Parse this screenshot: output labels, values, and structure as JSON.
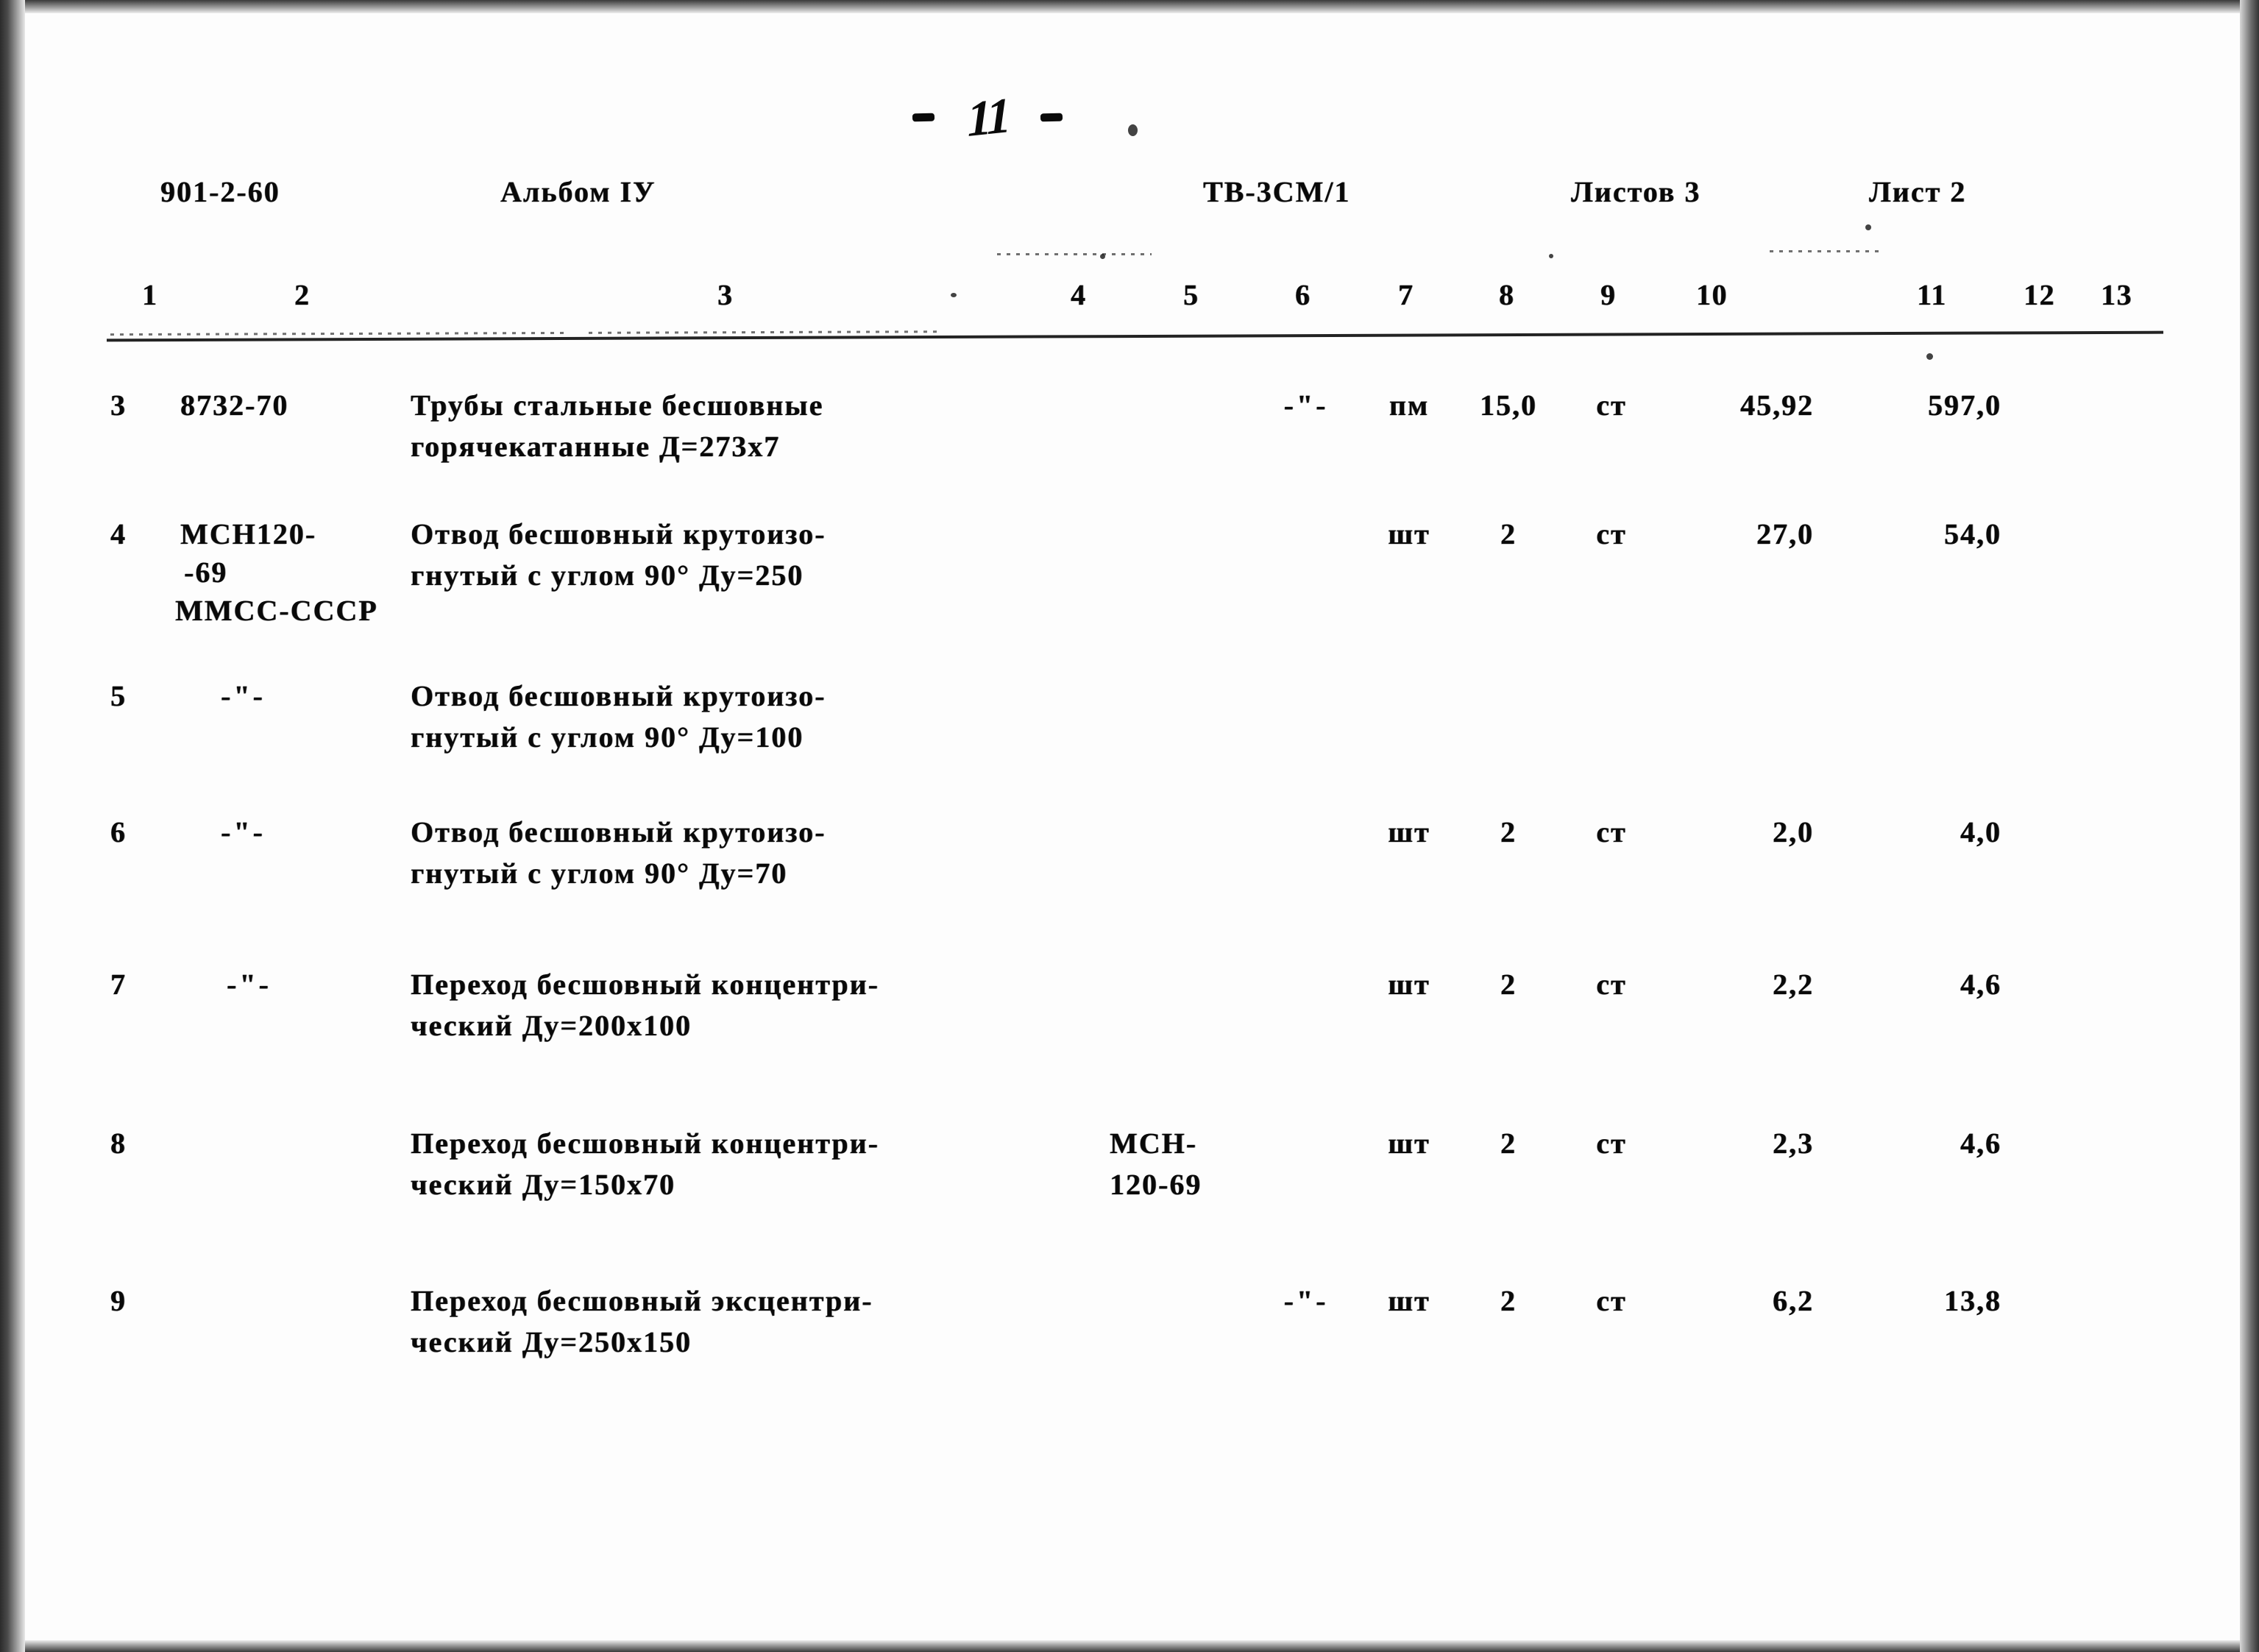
{
  "page": {
    "number": "11",
    "left_dash": "-",
    "right_dash": "-"
  },
  "header": {
    "project_code": "901-2-60",
    "album": "Альбом IУ",
    "drawing_code": "ТВ-3СМ/1",
    "sheets_total": "Листов 3",
    "sheet_current": "Лист 2"
  },
  "column_numbers": [
    "1",
    "2",
    "3",
    "4",
    "5",
    "6",
    "7",
    "8",
    "9",
    "10",
    "11",
    "12",
    "13"
  ],
  "rows": [
    {
      "pos": "3",
      "gost": "8732-70",
      "gost_line2": "",
      "gost_line3": "",
      "name_line1": "Трубы стальные бесшовные",
      "name_line2": "горячекатанные Д=273х7",
      "c5": "",
      "c5_line2": "",
      "c6": "-\"-",
      "c7": "пм",
      "c8": "15,0",
      "c9": "ст",
      "c10": "45,92",
      "c11": "597,0"
    },
    {
      "pos": "4",
      "gost": "МСН120-",
      "gost_line2": "-69",
      "gost_line3": "ММСС-СССР",
      "name_line1": "Отвод бесшовный крутоизо-",
      "name_line2": "гнутый с углом 90° Ду=250",
      "c5": "",
      "c5_line2": "",
      "c6": "",
      "c7": "шт",
      "c8": "2",
      "c9": "ст",
      "c10": "27,0",
      "c11": "54,0"
    },
    {
      "pos": "5",
      "gost": "-\"-",
      "gost_line2": "",
      "gost_line3": "",
      "name_line1": "Отвод бесшовный крутоизо-",
      "name_line2": "гнутый с углом 90° Ду=100",
      "c5": "",
      "c5_line2": "",
      "c6": "",
      "c7": "",
      "c8": "",
      "c9": "",
      "c10": "",
      "c11": ""
    },
    {
      "pos": "6",
      "gost": "-\"-",
      "gost_line2": "",
      "gost_line3": "",
      "name_line1": "Отвод бесшовный крутоизо-",
      "name_line2": "гнутый с углом 90° Ду=70",
      "c5": "",
      "c5_line2": "",
      "c6": "",
      "c7": "шт",
      "c8": "2",
      "c9": "ст",
      "c10": "2,0",
      "c11": "4,0"
    },
    {
      "pos": "7",
      "gost": "-\"-",
      "gost_line2": "",
      "gost_line3": "",
      "name_line1": "Переход бесшовный концентри-",
      "name_line2": "ческий Ду=200х100",
      "c5": "",
      "c5_line2": "",
      "c6": "",
      "c7": "шт",
      "c8": "2",
      "c9": "ст",
      "c10": "2,2",
      "c11": "4,6"
    },
    {
      "pos": "8",
      "gost": "",
      "gost_line2": "",
      "gost_line3": "",
      "name_line1": "Переход бесшовный концентри-",
      "name_line2": "ческий Ду=150х70",
      "c5": "МСН-",
      "c5_line2": "120-69",
      "c6": "",
      "c7": "шт",
      "c8": "2",
      "c9": "ст",
      "c10": "2,3",
      "c11": "4,6"
    },
    {
      "pos": "9",
      "gost": "",
      "gost_line2": "",
      "gost_line3": "",
      "name_line1": "Переход бесшовный эксцентри-",
      "name_line2": "ческий Ду=250х150",
      "c5": "",
      "c5_line2": "",
      "c6": "-\"-",
      "c7": "шт",
      "c8": "2",
      "c9": "ст",
      "c10": "6,2",
      "c11": "13,8"
    }
  ]
}
